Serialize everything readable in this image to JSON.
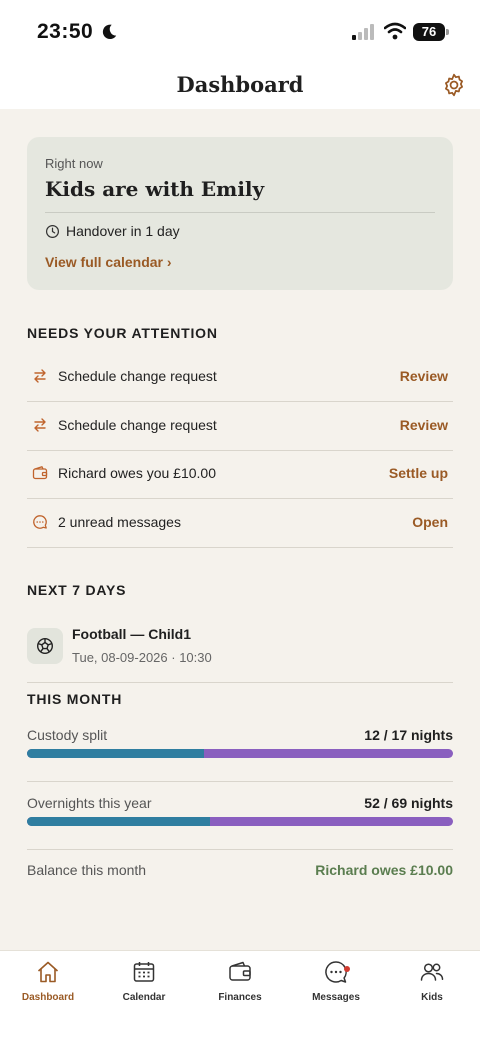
{
  "status_bar": {
    "time": "23:50",
    "battery": "76"
  },
  "header": {
    "title": "Dashboard"
  },
  "now_card": {
    "eyebrow": "Right now",
    "title": "Kids are with Emily",
    "handover": "Handover in 1 day",
    "link": "View full calendar ›"
  },
  "attention": {
    "title": "NEEDS YOUR ATTENTION",
    "items": [
      {
        "label": "Schedule change request",
        "action": "Review",
        "icon": "swap-icon"
      },
      {
        "label": "Schedule change request",
        "action": "Review",
        "icon": "swap-icon"
      },
      {
        "label": "Richard owes you £10.00",
        "action": "Settle up",
        "icon": "wallet-icon"
      },
      {
        "label": "2 unread messages",
        "action": "Open",
        "icon": "chat-icon"
      }
    ]
  },
  "next7": {
    "title": "NEXT 7 DAYS",
    "event": {
      "title": "Football — Child1",
      "subtitle": "Tue, 08-09-2026 · 10:30",
      "icon": "football-icon"
    }
  },
  "month": {
    "title": "THIS MONTH",
    "custody": {
      "label": "Custody split",
      "value": "12 / 17 nights",
      "fraction": 0.4157
    },
    "overnights": {
      "label": "Overnights this year",
      "value": "52 / 69 nights",
      "fraction": 0.4296
    },
    "balance": {
      "label": "Balance this month",
      "value": "Richard owes £10.00"
    }
  },
  "tabs": [
    {
      "label": "Dashboard",
      "icon": "home-icon",
      "active": true
    },
    {
      "label": "Calendar",
      "icon": "calendar-icon",
      "active": false
    },
    {
      "label": "Finances",
      "icon": "wallet-icon",
      "active": false
    },
    {
      "label": "Messages",
      "icon": "chat-icon",
      "active": false,
      "badge": true
    },
    {
      "label": "Kids",
      "icon": "people-icon",
      "active": false
    }
  ],
  "colors": {
    "accent": "#9a5a25",
    "positive": "#5a7d4f",
    "bar_primary": "#2f7ea0",
    "bar_secondary": "#8a5fbf",
    "badge": "#d13b30"
  }
}
